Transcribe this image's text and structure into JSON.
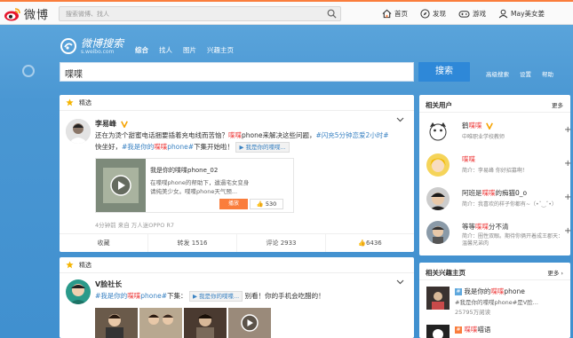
{
  "topbar": {
    "logo_text": "微博",
    "search_placeholder": "搜索微博、找人",
    "nav": [
      {
        "label": "首页",
        "icon": "home-icon"
      },
      {
        "label": "发现",
        "icon": "compass-icon"
      },
      {
        "label": "游戏",
        "icon": "gamepad-icon"
      },
      {
        "label": "May美女姜",
        "icon": "user-icon"
      }
    ]
  },
  "search_header": {
    "logo_title": "微博搜索",
    "logo_sub": "s.weibo.com",
    "tabs": [
      "综合",
      "找人",
      "图片",
      "兴趣主页"
    ],
    "query": "喋喋",
    "button_label": "搜索",
    "links": [
      "高级搜索",
      "设置",
      "帮助"
    ]
  },
  "feed": {
    "card1": {
      "header": "精选",
      "user": "李易峰",
      "text_a": "还在为烫个甜蜜电话捆要插着充电线而苦恼？",
      "text_hl1": "喋喋",
      "text_b": "phone来解决这些问题，",
      "tag1": "#闪充5分钟恋爱2小时#",
      "text_c": "快坐好，",
      "tag2": "#我是你的",
      "tag2_hl": "喋喋",
      "tag2_b": "phone#",
      "text_d": "下集开始啦！",
      "video_tag": "我是你的喋喋...",
      "link_title": "我是你的喋喋phone_02",
      "link_desc": "在喋喋phone的帮助下，邋遢宅女变身请纯美少女。喋喋phone天气预...",
      "link_btn": "播放",
      "link_likes": "530",
      "meta": "4分钟前 来自 万人迷OPPO R7",
      "actions": [
        {
          "label": "收藏"
        },
        {
          "label": "转发 1516"
        },
        {
          "label": "评论 2933"
        },
        {
          "label": "6436"
        }
      ]
    },
    "card2": {
      "header": "精选",
      "user": "V脸社长",
      "tag": "#我是你的",
      "tag_hl": "喋喋",
      "tag_b": "phone#",
      "text_a": "下集：",
      "video_tag": "我是你的喋喋...",
      "text_b": "别看！你的手机会吃醋的！"
    }
  },
  "related_users": {
    "title": "相关用户",
    "more": "更多",
    "users": [
      {
        "name_a": "鹤",
        "name_hl": "喋喋",
        "desc": "中唯职业学校教师"
      },
      {
        "name_a": "",
        "name_hl": "喋喋",
        "desc": "简介：李易峰 你好招募啊！"
      },
      {
        "name_a": "阿班是",
        "name_hl": "喋喋",
        "name_b": "的痴猫0_o",
        "desc": "简介：我喜欢的样子你都有~（•ˇ‿ˇ•）"
      },
      {
        "name_a": "等等",
        "name_hl": "喋喋",
        "name_b": "分不清",
        "desc": "简介：圈性双眼。期待你俩开着成王郡天：温馨兄弟肉"
      }
    ]
  },
  "related_topics": {
    "title": "相关兴趣主页",
    "more": "更多",
    "topics": [
      {
        "name_a": "我是你的",
        "name_hl": "喋喋",
        "name_b": "phone",
        "desc": "#我是你的喋喋phone#是V脸...",
        "count": "25795万阅读"
      },
      {
        "name_a": "",
        "name_hl": "喋喋",
        "name_b": "喵语",
        "desc": "",
        "count": ""
      }
    ]
  },
  "colors": {
    "accent": "#fa7d3c",
    "link": "#3b83c3",
    "highlight": "#e44444",
    "brand_blue": "#2e88d8"
  }
}
